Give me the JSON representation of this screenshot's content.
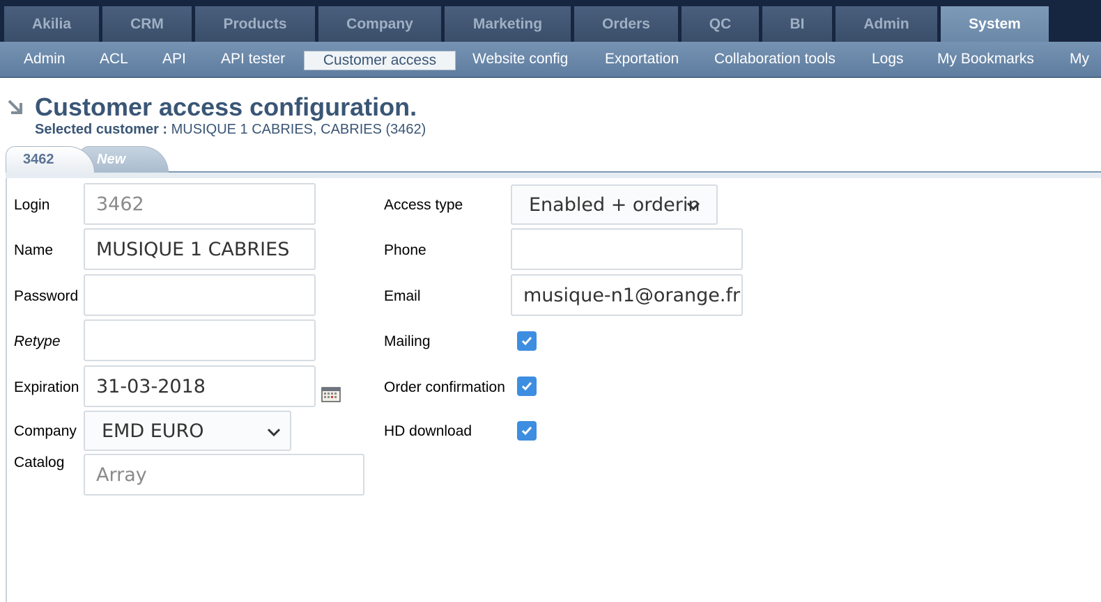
{
  "top_nav": [
    {
      "label": "Akilia"
    },
    {
      "label": "CRM"
    },
    {
      "label": "Products"
    },
    {
      "label": "Company"
    },
    {
      "label": "Marketing"
    },
    {
      "label": "Orders"
    },
    {
      "label": "QC"
    },
    {
      "label": "BI"
    },
    {
      "label": "Admin"
    },
    {
      "label": "System",
      "active": true
    }
  ],
  "sub_nav": [
    {
      "label": "Admin"
    },
    {
      "label": "ACL"
    },
    {
      "label": "API"
    },
    {
      "label": "API tester"
    },
    {
      "label": "Customer access",
      "active": true
    },
    {
      "label": "Website config"
    },
    {
      "label": "Exportation"
    },
    {
      "label": "Collaboration tools"
    },
    {
      "label": "Logs"
    },
    {
      "label": "My Bookmarks"
    },
    {
      "label": "My"
    }
  ],
  "header": {
    "title": "Customer access configuration.",
    "selected_label": "Selected customer :",
    "selected_value": "MUSIQUE 1 CABRIES, CABRIES (3462)"
  },
  "tabs": [
    {
      "label": "3462",
      "active": true
    },
    {
      "label": "New"
    }
  ],
  "form": {
    "login": {
      "label": "Login",
      "value": "3462"
    },
    "name": {
      "label": "Name",
      "value": "MUSIQUE 1 CABRIES"
    },
    "password": {
      "label": "Password",
      "value": ""
    },
    "retype": {
      "label": "Retype",
      "value": ""
    },
    "expiration": {
      "label": "Expiration",
      "value": "31-03-2018"
    },
    "company": {
      "label": "Company",
      "value": "EMD EURO"
    },
    "catalog": {
      "label": "Catalog",
      "value": "Array"
    },
    "access_type": {
      "label": "Access type",
      "value": "Enabled + orderin"
    },
    "phone": {
      "label": "Phone",
      "value": ""
    },
    "email": {
      "label": "Email",
      "value": "musique-n1@orange.fr"
    },
    "mailing": {
      "label": "Mailing",
      "checked": true
    },
    "order_confirmation": {
      "label": "Order confirmation",
      "checked": true
    },
    "hd_download": {
      "label": "HD download",
      "checked": true
    }
  },
  "icons": {
    "title_arrow": "arrow-down-right-icon",
    "calendar": "calendar-icon",
    "dropdown": "chevron-down-icon",
    "check": "checkmark-icon"
  },
  "colors": {
    "nav_dark": "#172640",
    "subnav": "#6a87a9",
    "title": "#3a5676",
    "checkbox": "#3d8ee0"
  }
}
